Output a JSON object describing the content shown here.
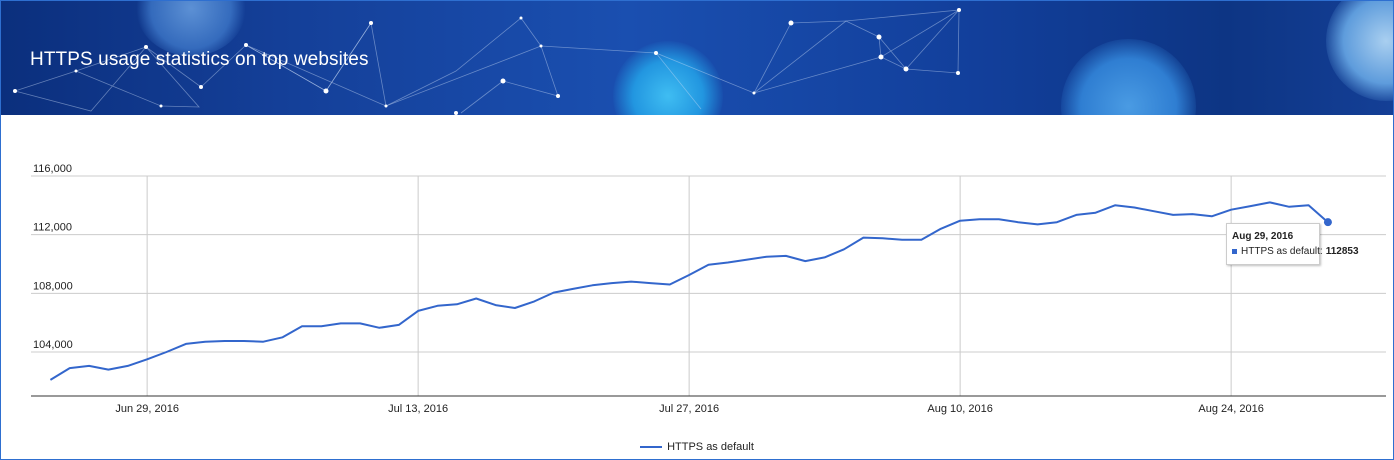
{
  "banner": {
    "title": "HTTPS usage statistics on top websites"
  },
  "chart_data": {
    "type": "line",
    "title": "",
    "xlabel": "",
    "ylabel": "",
    "xlim": [
      "2016-06-23",
      "2016-09-01"
    ],
    "ylim": [
      101000,
      116000
    ],
    "y_ticks": [
      104000,
      108000,
      112000,
      116000
    ],
    "y_tick_labels": [
      "104,000",
      "108,000",
      "112,000",
      "116,000"
    ],
    "x_ticks": [
      "2016-06-29",
      "2016-07-13",
      "2016-07-27",
      "2016-08-10",
      "2016-08-24"
    ],
    "x_tick_labels": [
      "Jun 29, 2016",
      "Jul 13, 2016",
      "Jul 27, 2016",
      "Aug 10, 2016",
      "Aug 24, 2016"
    ],
    "grid": true,
    "legend_position": "bottom",
    "series": [
      {
        "name": "HTTPS as default",
        "color": "#3366cc",
        "x": [
          "2016-06-24",
          "2016-06-25",
          "2016-06-26",
          "2016-06-27",
          "2016-06-28",
          "2016-06-29",
          "2016-06-30",
          "2016-07-01",
          "2016-07-02",
          "2016-07-03",
          "2016-07-04",
          "2016-07-05",
          "2016-07-06",
          "2016-07-07",
          "2016-07-08",
          "2016-07-09",
          "2016-07-10",
          "2016-07-11",
          "2016-07-12",
          "2016-07-13",
          "2016-07-14",
          "2016-07-15",
          "2016-07-16",
          "2016-07-17",
          "2016-07-18",
          "2016-07-19",
          "2016-07-20",
          "2016-07-21",
          "2016-07-22",
          "2016-07-23",
          "2016-07-24",
          "2016-07-25",
          "2016-07-26",
          "2016-07-27",
          "2016-07-28",
          "2016-07-29",
          "2016-07-30",
          "2016-07-31",
          "2016-08-01",
          "2016-08-02",
          "2016-08-03",
          "2016-08-04",
          "2016-08-05",
          "2016-08-06",
          "2016-08-07",
          "2016-08-08",
          "2016-08-09",
          "2016-08-10",
          "2016-08-11",
          "2016-08-12",
          "2016-08-13",
          "2016-08-14",
          "2016-08-15",
          "2016-08-16",
          "2016-08-17",
          "2016-08-18",
          "2016-08-19",
          "2016-08-20",
          "2016-08-21",
          "2016-08-22",
          "2016-08-23",
          "2016-08-24",
          "2016-08-25",
          "2016-08-26",
          "2016-08-27",
          "2016-08-28",
          "2016-08-29"
        ],
        "values": [
          102100,
          102900,
          103050,
          102800,
          103050,
          103500,
          104000,
          104550,
          104700,
          104750,
          104750,
          104700,
          105000,
          105750,
          105750,
          105950,
          105950,
          105650,
          105850,
          106800,
          107150,
          107250,
          107650,
          107200,
          107000,
          107450,
          108050,
          108300,
          108550,
          108700,
          108800,
          108700,
          108600,
          109250,
          109950,
          110100,
          110300,
          110500,
          110550,
          110200,
          110450,
          111000,
          111800,
          111750,
          111650,
          111650,
          112400,
          112950,
          113050,
          113050,
          112850,
          112700,
          112850,
          113350,
          113500,
          114000,
          113850,
          113600,
          113350,
          113400,
          113250,
          113700,
          113950,
          114200,
          113900,
          114000,
          112853
        ]
      }
    ]
  },
  "tooltip": {
    "date": "Aug 29, 2016",
    "series_label": "HTTPS as default:",
    "value": "112853"
  }
}
